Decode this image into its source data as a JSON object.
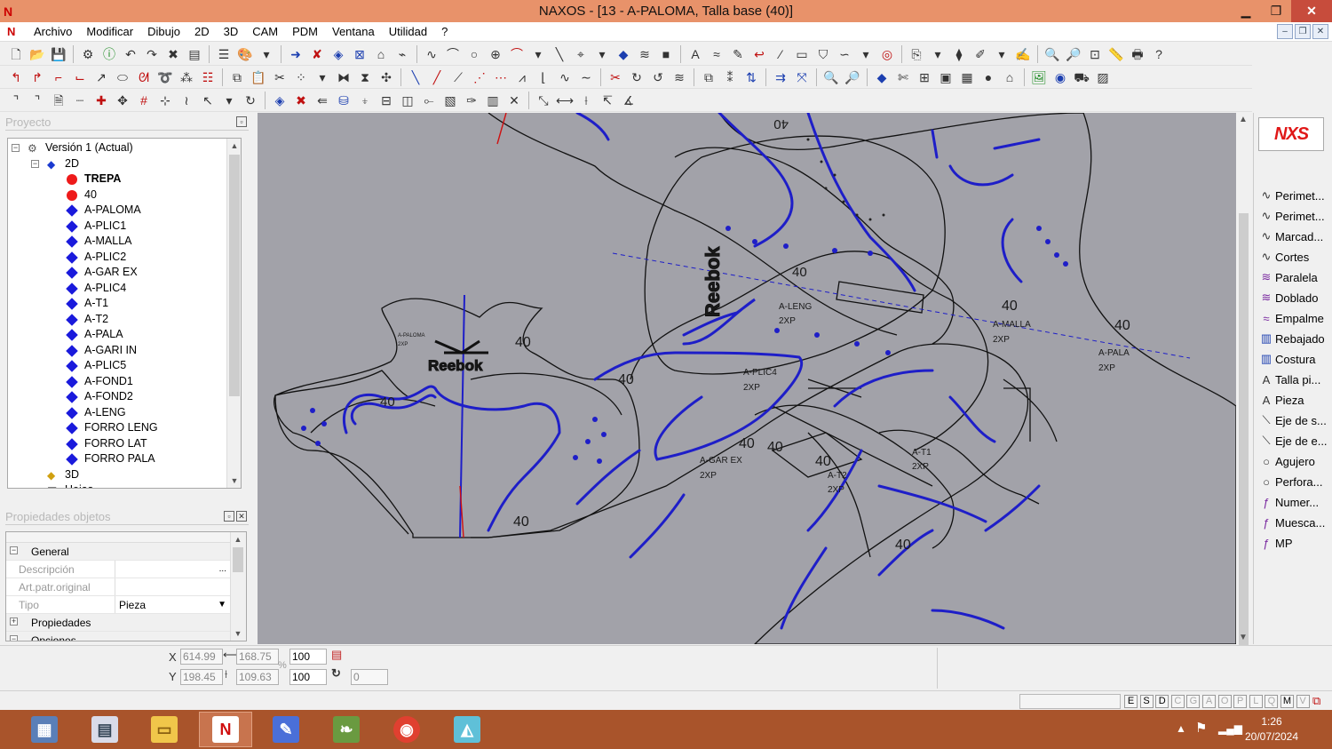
{
  "window": {
    "title": "NAXOS - [13 - A-PALOMA, Talla base (40)]",
    "app_icon": "N"
  },
  "menu": [
    "Archivo",
    "Modificar",
    "Dibujo",
    "2D",
    "3D",
    "CAM",
    "PDM",
    "Ventana",
    "Utilidad",
    "?"
  ],
  "project_panel": {
    "title": "Proyecto",
    "tree": [
      {
        "label": "Versión 1 (Actual)",
        "level": 0,
        "icon": "version-icon",
        "expander": "−"
      },
      {
        "label": "2D",
        "level": 1,
        "icon": "folder-2d-icon",
        "expander": "−"
      },
      {
        "label": "TREPA",
        "level": 2,
        "icon": "red-dot",
        "bold": true
      },
      {
        "label": "40",
        "level": 2,
        "icon": "red-dot"
      },
      {
        "label": "A-PALOMA",
        "level": 2,
        "icon": "blue-diamond",
        "selected": true
      },
      {
        "label": "A-PLIC1",
        "level": 2,
        "icon": "blue-diamond"
      },
      {
        "label": "A-MALLA",
        "level": 2,
        "icon": "blue-diamond"
      },
      {
        "label": "A-PLIC2",
        "level": 2,
        "icon": "blue-diamond"
      },
      {
        "label": "A-GAR EX",
        "level": 2,
        "icon": "blue-diamond"
      },
      {
        "label": "A-PLIC4",
        "level": 2,
        "icon": "blue-diamond"
      },
      {
        "label": "A-T1",
        "level": 2,
        "icon": "blue-diamond"
      },
      {
        "label": "A-T2",
        "level": 2,
        "icon": "blue-diamond"
      },
      {
        "label": "A-PALA",
        "level": 2,
        "icon": "blue-diamond"
      },
      {
        "label": "A-GARI IN",
        "level": 2,
        "icon": "blue-diamond"
      },
      {
        "label": "A-PLIC5",
        "level": 2,
        "icon": "blue-diamond"
      },
      {
        "label": "A-FOND1",
        "level": 2,
        "icon": "blue-diamond"
      },
      {
        "label": "A-FOND2",
        "level": 2,
        "icon": "blue-diamond"
      },
      {
        "label": "A-LENG",
        "level": 2,
        "icon": "blue-diamond"
      },
      {
        "label": "FORRO LENG",
        "level": 2,
        "icon": "blue-diamond"
      },
      {
        "label": "FORRO LAT",
        "level": 2,
        "icon": "blue-diamond"
      },
      {
        "label": "FORRO PALA",
        "level": 2,
        "icon": "blue-diamond"
      },
      {
        "label": "3D",
        "level": 1,
        "icon": "folder-3d-icon"
      },
      {
        "label": "Hojas",
        "level": 1,
        "icon": "sheets-icon"
      }
    ]
  },
  "properties_panel": {
    "title": "Propiedades objetos",
    "sections": {
      "general": "General",
      "propiedades": "Propiedades",
      "opciones": "Opciones"
    },
    "fields": {
      "descripcion_label": "Descripción",
      "descripcion_value": "",
      "descripcion_btn": "...",
      "art_label": "Art.patr.original",
      "art_value": "",
      "tipo_label": "Tipo",
      "tipo_value": "Pieza"
    }
  },
  "canvas": {
    "background": "#a2a2a9",
    "labels": [
      {
        "t": "40"
      },
      {
        "t": "40"
      },
      {
        "t": "40"
      },
      {
        "t": "40"
      },
      {
        "t": "40"
      },
      {
        "t": "40"
      },
      {
        "t": "40"
      },
      {
        "t": "40"
      },
      {
        "t": "40"
      },
      {
        "t": "40"
      },
      {
        "t": "40"
      },
      {
        "t": "40"
      },
      {
        "t": "A-LENG"
      },
      {
        "t": "2XP"
      },
      {
        "t": "A-MALLA"
      },
      {
        "t": "2XP"
      },
      {
        "t": "A-PALA"
      },
      {
        "t": "2XP"
      },
      {
        "t": "A-PLIC4"
      },
      {
        "t": "2XP"
      },
      {
        "t": "A-GAR EX"
      },
      {
        "t": "2XP"
      },
      {
        "t": "A-T1"
      },
      {
        "t": "2XP"
      },
      {
        "t": "A-T2"
      },
      {
        "t": "2XP"
      },
      {
        "t": "A-PALOMA"
      },
      {
        "t": "2XP"
      }
    ],
    "brand_text": "Reebok"
  },
  "right_palette": {
    "logo": "NXS",
    "items": [
      {
        "label": "Perimet...",
        "icon": "curve-icon"
      },
      {
        "label": "Perimet...",
        "icon": "curve-icon"
      },
      {
        "label": "Marcad...",
        "icon": "curve-icon"
      },
      {
        "label": "Cortes",
        "icon": "curve-icon"
      },
      {
        "label": "Paralela",
        "icon": "parallel-icon"
      },
      {
        "label": "Doblado",
        "icon": "fold-icon"
      },
      {
        "label": "Empalme",
        "icon": "splice-icon"
      },
      {
        "label": "Rebajado",
        "icon": "skive-icon"
      },
      {
        "label": "Costura",
        "icon": "seam-icon"
      },
      {
        "label": "Talla pi...",
        "icon": "text-a-icon"
      },
      {
        "label": "Pieza",
        "icon": "text-a-icon"
      },
      {
        "label": "Eje de s...",
        "icon": "axis-icon"
      },
      {
        "label": "Eje de e...",
        "icon": "axis-icon"
      },
      {
        "label": "Agujero",
        "icon": "circle-icon"
      },
      {
        "label": "Perfora...",
        "icon": "circle-icon"
      },
      {
        "label": "Numer...",
        "icon": "number-icon"
      },
      {
        "label": "Muesca...",
        "icon": "notch-icon"
      },
      {
        "label": "MP",
        "icon": "mp-icon"
      }
    ]
  },
  "coords": {
    "x_label": "X",
    "y_label": "Y",
    "x": "614.99",
    "y": "198.45",
    "width": "168.75",
    "height": "109.63",
    "scale_x": "100",
    "scale_y": "100",
    "angle": "0",
    "percent": "%"
  },
  "status_flags": [
    "E",
    "S",
    "D",
    "C",
    "G",
    "A",
    "O",
    "P",
    "L",
    "Q",
    "M",
    "V"
  ],
  "taskbar": {
    "time": "1:26",
    "date": "20/07/2024"
  }
}
